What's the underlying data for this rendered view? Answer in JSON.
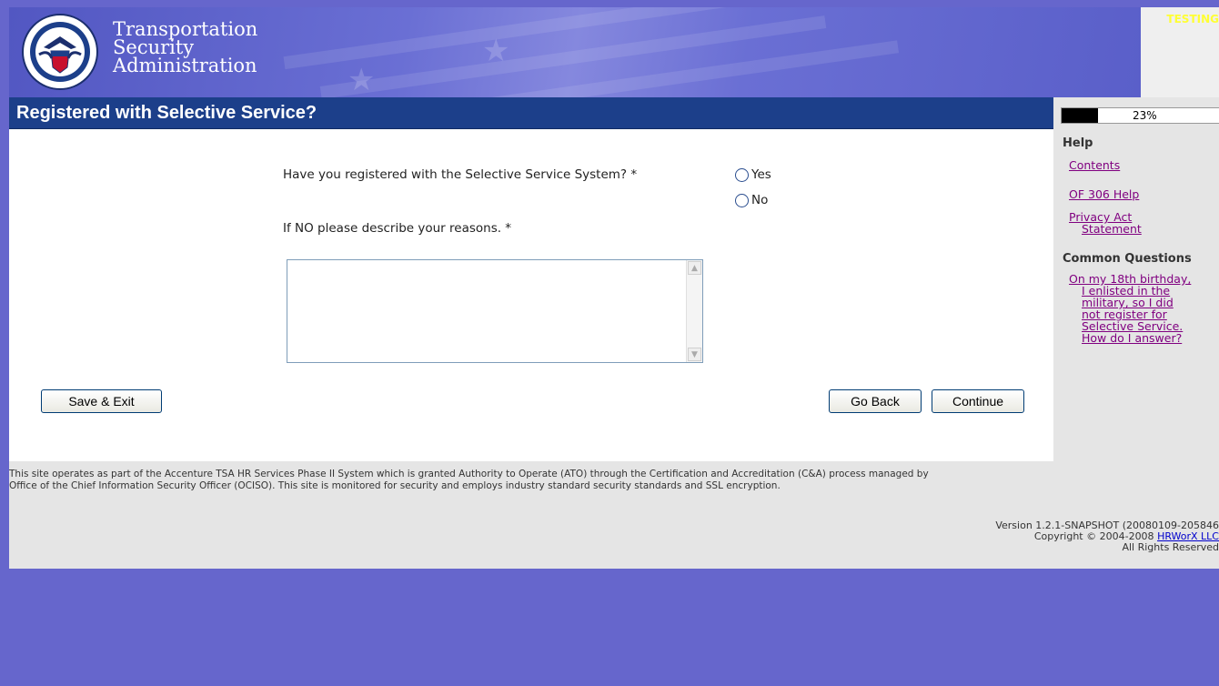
{
  "header": {
    "agency_line1": "Transportation",
    "agency_line2": "Security",
    "agency_line3": "Administration",
    "environment_label": "TESTING"
  },
  "page": {
    "title": "Registered with Selective Service?"
  },
  "progress": {
    "percent": 23,
    "label": "23%"
  },
  "form": {
    "question": "Have you registered with the Selective Service System? *",
    "options": [
      "Yes",
      "No"
    ],
    "selected": null,
    "reason_label": "If NO please describe your reasons. *",
    "reason_value": ""
  },
  "buttons": {
    "save_exit": "Save & Exit",
    "go_back": "Go Back",
    "continue": "Continue"
  },
  "help": {
    "heading": "Help",
    "contents": "Contents",
    "of306": "OF 306 Help",
    "privacy_line1": "Privacy Act",
    "privacy_line2": "Statement"
  },
  "common_questions": {
    "heading": "Common Questions",
    "q1_lines": [
      "On my 18th birthday,",
      "I enlisted in the",
      "military, so I did",
      "not register for",
      "Selective Service.",
      "How do I answer?"
    ]
  },
  "footer": {
    "notice_line1": "This site operates as part of the Accenture TSA HR Services Phase II System which is granted Authority to Operate (ATO) through the Certification and Accreditation (C&A) process managed by",
    "notice_line2": "Office of the Chief Information Security Officer (OCISO). This site is monitored for security and employs industry standard security standards and SSL encryption.",
    "version": "Version 1.2.1-SNAPSHOT (20080109-205846",
    "copyright_prefix": "Copyright © 2004-2008",
    "copyright_link": "HRWorX LLC",
    "rights": "All Rights Reserved"
  },
  "colors": {
    "background": "#6666cc",
    "title_bar": "#1c3f8a",
    "link_visited": "#800080",
    "testing_label": "#ffff33"
  }
}
